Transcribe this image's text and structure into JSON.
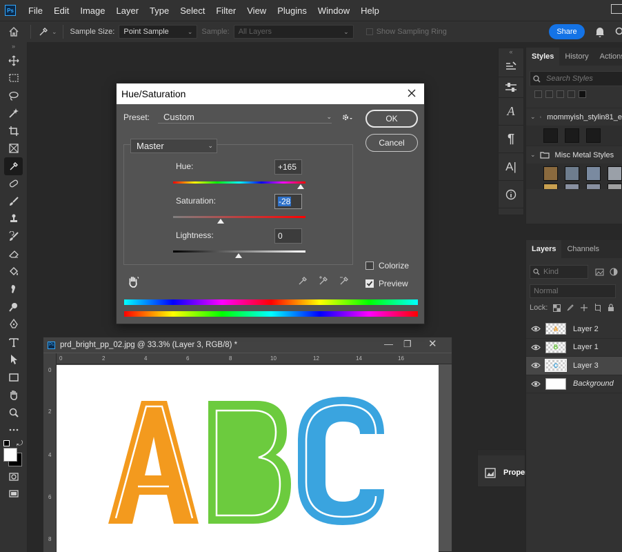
{
  "app": {
    "logo": "Ps"
  },
  "menu": [
    "File",
    "Edit",
    "Image",
    "Layer",
    "Type",
    "Select",
    "Filter",
    "View",
    "Plugins",
    "Window",
    "Help"
  ],
  "options": {
    "sample_size_label": "Sample Size:",
    "sample_size_value": "Point Sample",
    "sample_label": "Sample:",
    "sample_value": "All Layers",
    "sampling_ring_label": "Show Sampling Ring",
    "share_label": "Share"
  },
  "dialog": {
    "title": "Hue/Saturation",
    "preset_label": "Preset:",
    "preset_value": "Custom",
    "ok_label": "OK",
    "cancel_label": "Cancel",
    "channel_value": "Master",
    "hue_label": "Hue:",
    "hue_value": "+165",
    "saturation_label": "Saturation:",
    "saturation_value": "-28",
    "lightness_label": "Lightness:",
    "lightness_value": "0",
    "colorize_label": "Colorize",
    "colorize_checked": false,
    "preview_label": "Preview",
    "preview_checked": true
  },
  "document": {
    "title": "prd_bright_pp_02.jpg @ 33.3% (Layer 3, RGB/8) *",
    "ruler_h": [
      "0",
      "2",
      "4",
      "6",
      "8",
      "10",
      "12",
      "14",
      "16"
    ],
    "ruler_v": [
      "0",
      "2",
      "4",
      "6",
      "8"
    ],
    "letters": [
      {
        "char": "A",
        "color": "#f39a1e"
      },
      {
        "char": "B",
        "color": "#6ccb3e"
      },
      {
        "char": "C",
        "color": "#3aa4df"
      }
    ]
  },
  "styles_panel": {
    "tabs": [
      "Styles",
      "History",
      "Actions"
    ],
    "search_placeholder": "Search Styles",
    "folders": [
      "mommyish_stylin81_e",
      "Misc Metal Styles"
    ]
  },
  "properties_chip": {
    "label": "Proper"
  },
  "layers_panel": {
    "tabs": [
      "Layers",
      "Channels"
    ],
    "kind_label": "Kind",
    "blend_mode": "Normal",
    "lock_label": "Lock:",
    "layers": [
      {
        "name": "Layer 2",
        "thumb": "A",
        "thumb_color": "#f39a1e",
        "selected": false,
        "italic": false
      },
      {
        "name": "Layer 1",
        "thumb": "B",
        "thumb_color": "#6ccb3e",
        "selected": false,
        "italic": false
      },
      {
        "name": "Layer 3",
        "thumb": "C",
        "thumb_color": "#3aa4df",
        "selected": true,
        "italic": false
      },
      {
        "name": "Background",
        "thumb": "",
        "thumb_color": "#ffffff",
        "selected": false,
        "italic": true
      }
    ]
  },
  "tools": [
    "move-tool-icon",
    "marquee-tool-icon",
    "lasso-tool-icon",
    "magic-wand-icon",
    "crop-tool-icon",
    "frame-tool-icon",
    "eyedropper-tool-icon",
    "healing-brush-icon",
    "brush-tool-icon",
    "stamp-tool-icon",
    "history-brush-icon",
    "eraser-tool-icon",
    "paint-bucket-icon",
    "smudge-tool-icon",
    "dodge-tool-icon",
    "pen-tool-icon",
    "type-tool-icon",
    "path-select-icon",
    "rectangle-tool-icon",
    "hand-tool-icon",
    "zoom-tool-icon",
    "more-tools-icon"
  ]
}
